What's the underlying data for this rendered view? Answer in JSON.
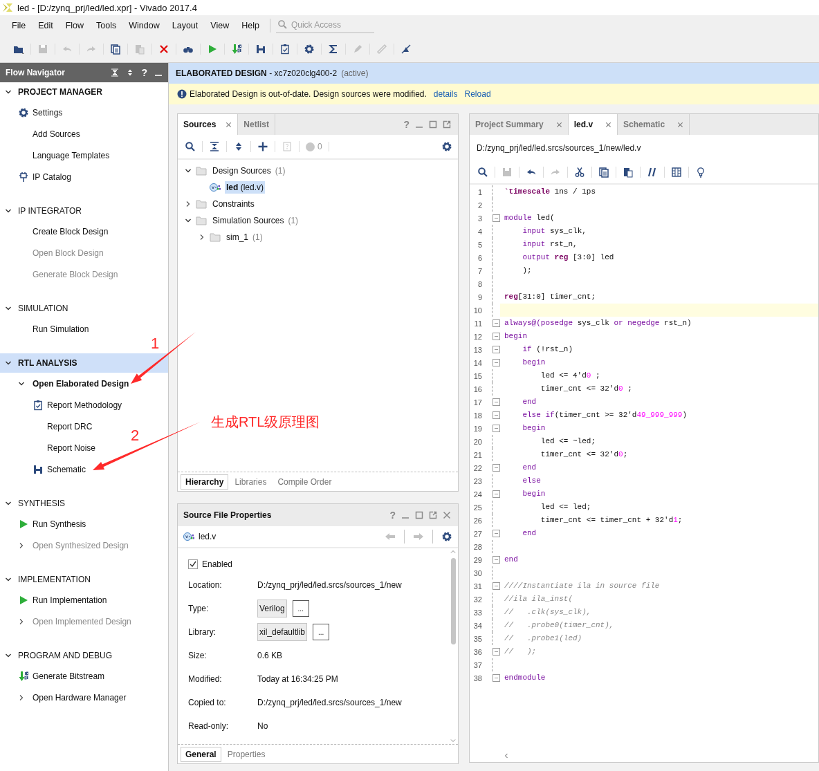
{
  "window": {
    "title": "led - [D:/zynq_prj/led/led.xpr] - Vivado 2017.4"
  },
  "menu": [
    "File",
    "Edit",
    "Flow",
    "Tools",
    "Window",
    "Layout",
    "View",
    "Help"
  ],
  "quick_access": {
    "placeholder": "Quick Access"
  },
  "toolbar": [
    {
      "kind": "open",
      "disabled": false
    },
    {
      "kind": "save",
      "disabled": true
    },
    {
      "kind": "undo",
      "disabled": true
    },
    {
      "kind": "redo",
      "disabled": true
    },
    {
      "kind": "copy",
      "disabled": false
    },
    {
      "kind": "paste",
      "disabled": true
    },
    {
      "kind": "delete",
      "disabled": false
    },
    {
      "kind": "binoculars",
      "disabled": false
    },
    {
      "kind": "run",
      "disabled": false
    },
    {
      "kind": "bitstream",
      "disabled": false
    },
    {
      "kind": "schematic",
      "disabled": false
    },
    {
      "kind": "report",
      "disabled": false
    },
    {
      "kind": "gear",
      "disabled": false
    },
    {
      "kind": "sigma",
      "disabled": false
    },
    {
      "kind": "pen",
      "disabled": true
    },
    {
      "kind": "ruler",
      "disabled": true
    },
    {
      "kind": "crossed",
      "disabled": false
    }
  ],
  "flow_navigator": {
    "title": "Flow Navigator",
    "help": "?",
    "sections": [
      {
        "title": "PROJECT MANAGER",
        "expanded": true,
        "selected": false,
        "active": true,
        "items": [
          {
            "label": "Settings",
            "kind": "gear",
            "disabled": false,
            "active": false
          },
          {
            "label": "Add Sources",
            "disabled": false,
            "active": false
          },
          {
            "label": "Language Templates",
            "disabled": false,
            "active": false
          },
          {
            "label": "IP Catalog",
            "kind": "chip",
            "disabled": false,
            "active": false
          }
        ]
      },
      {
        "title": "IP INTEGRATOR",
        "expanded": true,
        "selected": false,
        "active": false,
        "items": [
          {
            "label": "Create Block Design",
            "disabled": false,
            "active": false
          },
          {
            "label": "Open Block Design",
            "disabled": true,
            "active": false
          },
          {
            "label": "Generate Block Design",
            "disabled": true,
            "active": false
          }
        ]
      },
      {
        "title": "SIMULATION",
        "expanded": true,
        "selected": false,
        "active": false,
        "items": [
          {
            "label": "Run Simulation",
            "disabled": false,
            "active": false
          }
        ]
      },
      {
        "title": "RTL ANALYSIS",
        "expanded": true,
        "selected": true,
        "active": true,
        "items": [
          {
            "label": "Open Elaborated Design",
            "disabled": false,
            "active": true,
            "expanded": true,
            "children": [
              {
                "label": "Report Methodology",
                "kind": "report",
                "disabled": false,
                "active": false
              },
              {
                "label": "Report DRC",
                "disabled": false,
                "active": false
              },
              {
                "label": "Report Noise",
                "disabled": false,
                "active": false
              },
              {
                "label": "Schematic",
                "kind": "schematic",
                "disabled": false,
                "active": false
              }
            ]
          }
        ]
      },
      {
        "title": "SYNTHESIS",
        "expanded": true,
        "selected": false,
        "active": false,
        "items": [
          {
            "label": "Run Synthesis",
            "kind": "run",
            "disabled": false,
            "active": false
          },
          {
            "label": "Open Synthesized Design",
            "disabled": true,
            "active": false,
            "expanded": false
          }
        ]
      },
      {
        "title": "IMPLEMENTATION",
        "expanded": true,
        "selected": false,
        "active": false,
        "items": [
          {
            "label": "Run Implementation",
            "kind": "run",
            "disabled": false,
            "active": false
          },
          {
            "label": "Open Implemented Design",
            "disabled": true,
            "active": false,
            "expanded": false
          }
        ]
      },
      {
        "title": "PROGRAM AND DEBUG",
        "expanded": true,
        "selected": false,
        "active": false,
        "items": [
          {
            "label": "Generate Bitstream",
            "kind": "bitstream",
            "disabled": false,
            "active": false
          },
          {
            "label": "Open Hardware Manager",
            "disabled": false,
            "active": false,
            "expanded": false
          }
        ]
      }
    ]
  },
  "design_header": {
    "title": "ELABORATED DESIGN",
    "part": "- xc7z020clg400-2",
    "status": "(active)"
  },
  "banner": {
    "message": "Elaborated Design is out-of-date. Design sources were modified.",
    "links": [
      "details",
      "Reload"
    ]
  },
  "sources_panel": {
    "tabs": [
      {
        "label": "Sources",
        "selected": true,
        "closable": true
      },
      {
        "label": "Netlist",
        "selected": false,
        "closable": false
      }
    ],
    "help": "?",
    "toolbar": [
      {
        "kind": "search",
        "disabled": false
      },
      {
        "kind": "collapse",
        "disabled": false
      },
      {
        "kind": "expand",
        "disabled": false
      },
      {
        "kind": "add",
        "disabled": false
      },
      {
        "kind": "helpdoc",
        "disabled": true
      }
    ],
    "status_count": "0",
    "tree": [
      {
        "label": "Design Sources",
        "count": "(1)",
        "kind": "folder",
        "expanded": true,
        "selected": false,
        "children": [
          {
            "label": "**led** (led.v)",
            "kind": "verilog",
            "selected": true
          }
        ]
      },
      {
        "label": "Constraints",
        "kind": "folder",
        "expanded": false,
        "selected": false
      },
      {
        "label": "Simulation Sources",
        "count": "(1)",
        "kind": "folder",
        "expanded": true,
        "selected": false,
        "children": [
          {
            "label": "sim_1",
            "count": "(1)",
            "kind": "folder",
            "expanded": false,
            "selected": false
          }
        ]
      }
    ],
    "bottom_tabs": [
      {
        "label": "Hierarchy",
        "selected": true
      },
      {
        "label": "Libraries",
        "selected": false
      },
      {
        "label": "Compile Order",
        "selected": false
      }
    ]
  },
  "properties_panel": {
    "title": "Source File Properties",
    "help": "?",
    "file": "led.v",
    "enabled": {
      "label": "Enabled",
      "checked": true
    },
    "rows": [
      {
        "label": "Location:",
        "kind": "text",
        "value": "D:/zynq_prj/led/led.srcs/sources_1/new"
      },
      {
        "label": "Type:",
        "kind": "field",
        "value": "Verilog",
        "button": "..."
      },
      {
        "label": "Library:",
        "kind": "field",
        "value": "xil_defaultlib",
        "button": "..."
      },
      {
        "label": "Size:",
        "kind": "text",
        "value": "0.6 KB"
      },
      {
        "label": "Modified:",
        "kind": "text",
        "value": "Today at 16:34:25 PM"
      },
      {
        "label": "Copied to:",
        "kind": "text",
        "value": "D:/zynq_prj/led/led.srcs/sources_1/new"
      },
      {
        "label": "Read-only:",
        "kind": "text",
        "value": "No"
      }
    ],
    "bottom_tabs": [
      {
        "label": "General",
        "selected": true
      },
      {
        "label": "Properties",
        "selected": false
      }
    ]
  },
  "editor": {
    "tabs": [
      {
        "label": "Project Summary",
        "selected": false
      },
      {
        "label": "led.v",
        "selected": true
      },
      {
        "label": "Schematic",
        "selected": false
      }
    ],
    "path": "D:/zynq_prj/led/led.srcs/sources_1/new/led.v",
    "toolbar": [
      {
        "kind": "search",
        "disabled": false
      },
      {
        "kind": "save",
        "disabled": true
      },
      {
        "kind": "undo",
        "disabled": false
      },
      {
        "kind": "redo",
        "disabled": true
      },
      {
        "kind": "cut",
        "disabled": false
      },
      {
        "kind": "copy",
        "disabled": false
      },
      {
        "kind": "paste",
        "disabled": false
      },
      {
        "kind": "comment",
        "disabled": false
      },
      {
        "kind": "columns",
        "disabled": false
      },
      {
        "kind": "bulb",
        "disabled": false
      }
    ],
    "lines": [
      {
        "n": "1",
        "fold": false,
        "current": false,
        "tokens": [
          {
            "kind": "bold",
            "text": "`timescale"
          },
          {
            "kind": "plain",
            "text": " 1ns / 1ps"
          }
        ]
      },
      {
        "n": "2",
        "fold": false,
        "current": false
      },
      {
        "n": "3",
        "fold": true,
        "current": false,
        "tokens": [
          {
            "kind": "kw",
            "text": "module"
          },
          {
            "kind": "plain",
            "text": " led("
          }
        ]
      },
      {
        "n": "4",
        "fold": false,
        "current": false,
        "tokens": [
          {
            "kind": "kw",
            "text": "    input"
          },
          {
            "kind": "plain",
            "text": " sys_clk,"
          }
        ]
      },
      {
        "n": "5",
        "fold": false,
        "current": false,
        "tokens": [
          {
            "kind": "kw",
            "text": "    input"
          },
          {
            "kind": "plain",
            "text": " rst_n,"
          }
        ]
      },
      {
        "n": "6",
        "fold": false,
        "current": false,
        "tokens": [
          {
            "kind": "kw",
            "text": "    output"
          },
          {
            "kind": "bold",
            "text": " reg"
          },
          {
            "kind": "plain",
            "text": " [3:0] led"
          }
        ]
      },
      {
        "n": "7",
        "fold": false,
        "current": false,
        "tokens": [
          {
            "kind": "plain",
            "text": "    );"
          }
        ]
      },
      {
        "n": "8",
        "fold": false,
        "current": false
      },
      {
        "n": "9",
        "fold": false,
        "current": false,
        "tokens": [
          {
            "kind": "bold",
            "text": "reg"
          },
          {
            "kind": "plain",
            "text": "[31:0] timer_cnt;"
          }
        ]
      },
      {
        "n": "10",
        "fold": false,
        "current": true
      },
      {
        "n": "11",
        "fold": true,
        "current": false,
        "tokens": [
          {
            "kind": "kw",
            "text": "always@(posedge"
          },
          {
            "kind": "plain",
            "text": " sys_clk "
          },
          {
            "kind": "kw",
            "text": "or negedge"
          },
          {
            "kind": "plain",
            "text": " rst_n)"
          }
        ]
      },
      {
        "n": "12",
        "fold": true,
        "current": false,
        "tokens": [
          {
            "kind": "kw",
            "text": "begin"
          }
        ]
      },
      {
        "n": "13",
        "fold": true,
        "current": false,
        "tokens": [
          {
            "kind": "kw",
            "text": "    if"
          },
          {
            "kind": "plain",
            "text": " (!rst_n)"
          }
        ]
      },
      {
        "n": "14",
        "fold": true,
        "current": false,
        "tokens": [
          {
            "kind": "kw",
            "text": "    begin"
          }
        ]
      },
      {
        "n": "15",
        "fold": false,
        "current": false,
        "tokens": [
          {
            "kind": "plain",
            "text": "        led <= 4'd"
          },
          {
            "kind": "num",
            "text": "0"
          },
          {
            "kind": "plain",
            "text": " ;"
          }
        ]
      },
      {
        "n": "16",
        "fold": false,
        "current": false,
        "tokens": [
          {
            "kind": "plain",
            "text": "        timer_cnt <= 32'd"
          },
          {
            "kind": "num",
            "text": "0"
          },
          {
            "kind": "plain",
            "text": " ;"
          }
        ]
      },
      {
        "n": "17",
        "fold": true,
        "current": false,
        "tokens": [
          {
            "kind": "kw",
            "text": "    end"
          }
        ]
      },
      {
        "n": "18",
        "fold": true,
        "current": false,
        "tokens": [
          {
            "kind": "kw",
            "text": "    else if"
          },
          {
            "kind": "plain",
            "text": "(timer_cnt >= 32'd"
          },
          {
            "kind": "num",
            "text": "49_999_999"
          },
          {
            "kind": "plain",
            "text": ")"
          }
        ]
      },
      {
        "n": "19",
        "fold": true,
        "current": false,
        "tokens": [
          {
            "kind": "kw",
            "text": "    begin"
          }
        ]
      },
      {
        "n": "20",
        "fold": false,
        "current": false,
        "tokens": [
          {
            "kind": "plain",
            "text": "        led <= ~led;"
          }
        ]
      },
      {
        "n": "21",
        "fold": false,
        "current": false,
        "tokens": [
          {
            "kind": "plain",
            "text": "        timer_cnt <= 32'd"
          },
          {
            "kind": "num",
            "text": "0"
          },
          {
            "kind": "plain",
            "text": ";"
          }
        ]
      },
      {
        "n": "22",
        "fold": true,
        "current": false,
        "tokens": [
          {
            "kind": "kw",
            "text": "    end"
          }
        ]
      },
      {
        "n": "23",
        "fold": false,
        "current": false,
        "tokens": [
          {
            "kind": "kw",
            "text": "    else"
          }
        ]
      },
      {
        "n": "24",
        "fold": true,
        "current": false,
        "tokens": [
          {
            "kind": "kw",
            "text": "    begin"
          }
        ]
      },
      {
        "n": "25",
        "fold": false,
        "current": false,
        "tokens": [
          {
            "kind": "plain",
            "text": "        led <= led;"
          }
        ]
      },
      {
        "n": "26",
        "fold": false,
        "current": false,
        "tokens": [
          {
            "kind": "plain",
            "text": "        timer_cnt <= timer_cnt + 32'd"
          },
          {
            "kind": "num",
            "text": "1"
          },
          {
            "kind": "plain",
            "text": ";"
          }
        ]
      },
      {
        "n": "27",
        "fold": true,
        "current": false,
        "tokens": [
          {
            "kind": "kw",
            "text": "    end"
          }
        ]
      },
      {
        "n": "28",
        "fold": false,
        "current": false
      },
      {
        "n": "29",
        "fold": true,
        "current": false,
        "tokens": [
          {
            "kind": "kw",
            "text": "end"
          }
        ]
      },
      {
        "n": "30",
        "fold": false,
        "current": false
      },
      {
        "n": "31",
        "fold": true,
        "current": false,
        "tokens": [
          {
            "kind": "comment",
            "text": "////Instantiate ila in source file"
          }
        ]
      },
      {
        "n": "32",
        "fold": false,
        "current": false,
        "tokens": [
          {
            "kind": "comment",
            "text": "//ila ila_inst("
          }
        ]
      },
      {
        "n": "33",
        "fold": false,
        "current": false,
        "tokens": [
          {
            "kind": "comment",
            "text": "//   .clk(sys_clk),"
          }
        ]
      },
      {
        "n": "34",
        "fold": false,
        "current": false,
        "tokens": [
          {
            "kind": "comment",
            "text": "//   .probe0(timer_cnt),"
          }
        ]
      },
      {
        "n": "35",
        "fold": false,
        "current": false,
        "tokens": [
          {
            "kind": "comment",
            "text": "//   .probe1(led)"
          }
        ]
      },
      {
        "n": "36",
        "fold": true,
        "current": false,
        "tokens": [
          {
            "kind": "comment",
            "text": "//   );"
          }
        ]
      },
      {
        "n": "37",
        "fold": false,
        "current": false
      },
      {
        "n": "38",
        "fold": true,
        "current": false,
        "tokens": [
          {
            "kind": "kw",
            "text": "endmodule"
          }
        ]
      }
    ]
  },
  "annotations": [
    {
      "text": "1"
    },
    {
      "text": "2"
    },
    {
      "text": "生成RTL级原理图"
    }
  ]
}
